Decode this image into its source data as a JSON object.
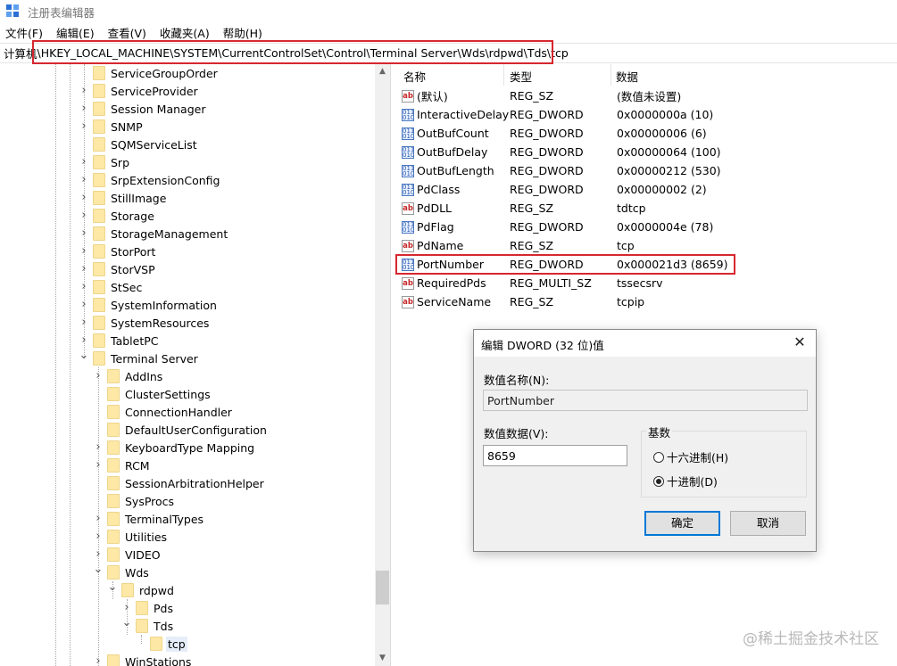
{
  "app": {
    "title": "注册表编辑器"
  },
  "menu": [
    "文件(F)",
    "编辑(E)",
    "查看(V)",
    "收藏夹(A)",
    "帮助(H)"
  ],
  "address": {
    "prefix": "计算机",
    "path": "\\HKEY_LOCAL_MACHINE\\SYSTEM\\CurrentControlSet\\Control\\Terminal Server\\Wds\\rdpwd\\Tds\\tcp"
  },
  "tree": {
    "items": [
      {
        "label": "ServiceGroupOrder",
        "level": 0,
        "expand": "none"
      },
      {
        "label": "ServiceProvider",
        "level": 0,
        "expand": "collapsed"
      },
      {
        "label": "Session Manager",
        "level": 0,
        "expand": "collapsed"
      },
      {
        "label": "SNMP",
        "level": 0,
        "expand": "collapsed"
      },
      {
        "label": "SQMServiceList",
        "level": 0,
        "expand": "none"
      },
      {
        "label": "Srp",
        "level": 0,
        "expand": "collapsed"
      },
      {
        "label": "SrpExtensionConfig",
        "level": 0,
        "expand": "collapsed"
      },
      {
        "label": "StillImage",
        "level": 0,
        "expand": "collapsed"
      },
      {
        "label": "Storage",
        "level": 0,
        "expand": "collapsed"
      },
      {
        "label": "StorageManagement",
        "level": 0,
        "expand": "collapsed"
      },
      {
        "label": "StorPort",
        "level": 0,
        "expand": "collapsed"
      },
      {
        "label": "StorVSP",
        "level": 0,
        "expand": "collapsed"
      },
      {
        "label": "StSec",
        "level": 0,
        "expand": "collapsed"
      },
      {
        "label": "SystemInformation",
        "level": 0,
        "expand": "collapsed"
      },
      {
        "label": "SystemResources",
        "level": 0,
        "expand": "collapsed"
      },
      {
        "label": "TabletPC",
        "level": 0,
        "expand": "collapsed"
      },
      {
        "label": "Terminal Server",
        "level": 0,
        "expand": "expanded"
      },
      {
        "label": "AddIns",
        "level": 1,
        "expand": "collapsed"
      },
      {
        "label": "ClusterSettings",
        "level": 1,
        "expand": "none"
      },
      {
        "label": "ConnectionHandler",
        "level": 1,
        "expand": "none"
      },
      {
        "label": "DefaultUserConfiguration",
        "level": 1,
        "expand": "none"
      },
      {
        "label": "KeyboardType Mapping",
        "level": 1,
        "expand": "collapsed"
      },
      {
        "label": "RCM",
        "level": 1,
        "expand": "collapsed"
      },
      {
        "label": "SessionArbitrationHelper",
        "level": 1,
        "expand": "none"
      },
      {
        "label": "SysProcs",
        "level": 1,
        "expand": "none"
      },
      {
        "label": "TerminalTypes",
        "level": 1,
        "expand": "collapsed"
      },
      {
        "label": "Utilities",
        "level": 1,
        "expand": "collapsed"
      },
      {
        "label": "VIDEO",
        "level": 1,
        "expand": "collapsed"
      },
      {
        "label": "Wds",
        "level": 1,
        "expand": "expanded"
      },
      {
        "label": "rdpwd",
        "level": 2,
        "expand": "expanded"
      },
      {
        "label": "Pds",
        "level": 3,
        "expand": "collapsed"
      },
      {
        "label": "Tds",
        "level": 3,
        "expand": "expanded"
      },
      {
        "label": "tcp",
        "level": 4,
        "expand": "none",
        "selected": true
      },
      {
        "label": "WinStations",
        "level": 1,
        "expand": "collapsed"
      }
    ]
  },
  "list": {
    "headers": {
      "name": "名称",
      "type": "类型",
      "data": "数据"
    },
    "rows": [
      {
        "icon": "string-value-icon",
        "name": "(默认)",
        "type": "REG_SZ",
        "data": "(数值未设置)"
      },
      {
        "icon": "binary-value-icon",
        "name": "InteractiveDelay",
        "type": "REG_DWORD",
        "data": "0x0000000a (10)"
      },
      {
        "icon": "binary-value-icon",
        "name": "OutBufCount",
        "type": "REG_DWORD",
        "data": "0x00000006 (6)"
      },
      {
        "icon": "binary-value-icon",
        "name": "OutBufDelay",
        "type": "REG_DWORD",
        "data": "0x00000064 (100)"
      },
      {
        "icon": "binary-value-icon",
        "name": "OutBufLength",
        "type": "REG_DWORD",
        "data": "0x00000212 (530)"
      },
      {
        "icon": "binary-value-icon",
        "name": "PdClass",
        "type": "REG_DWORD",
        "data": "0x00000002 (2)"
      },
      {
        "icon": "string-value-icon",
        "name": "PdDLL",
        "type": "REG_SZ",
        "data": "tdtcp"
      },
      {
        "icon": "binary-value-icon",
        "name": "PdFlag",
        "type": "REG_DWORD",
        "data": "0x0000004e (78)"
      },
      {
        "icon": "string-value-icon",
        "name": "PdName",
        "type": "REG_SZ",
        "data": "tcp"
      },
      {
        "icon": "binary-value-icon",
        "name": "PortNumber",
        "type": "REG_DWORD",
        "data": "0x000021d3 (8659)",
        "highlighted": true
      },
      {
        "icon": "string-value-icon",
        "name": "RequiredPds",
        "type": "REG_MULTI_SZ",
        "data": "tssecsrv"
      },
      {
        "icon": "string-value-icon",
        "name": "ServiceName",
        "type": "REG_SZ",
        "data": "tcpip"
      }
    ]
  },
  "dialog": {
    "title": "编辑 DWORD (32 位)值",
    "name_label": "数值名称(N):",
    "name_value": "PortNumber",
    "data_label": "数值数据(V):",
    "data_value": "8659",
    "base_label": "基数",
    "radio_hex": "十六进制(H)",
    "radio_dec": "十进制(D)",
    "selected_base": "decimal",
    "ok": "确定",
    "cancel": "取消"
  },
  "watermark": "@稀土掘金技术社区",
  "colors": {
    "highlight_box": "#d6272f",
    "folder": "#fde8a6",
    "accent": "#0078d7"
  }
}
